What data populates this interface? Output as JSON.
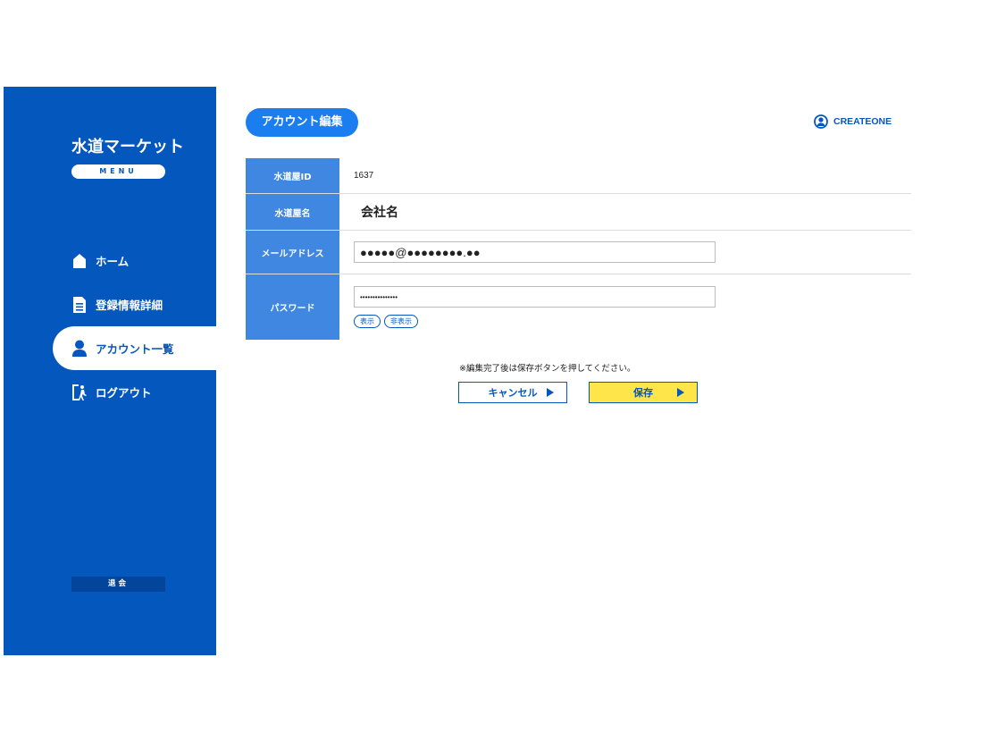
{
  "sidebar": {
    "brand": "水道マーケット",
    "menu_label": "MENU",
    "items": [
      {
        "label": "ホーム",
        "icon": "home-icon"
      },
      {
        "label": "登録情報詳細",
        "icon": "document-icon"
      },
      {
        "label": "アカウント一覧",
        "icon": "user-icon",
        "active": true
      },
      {
        "label": "ログアウト",
        "icon": "logout-icon"
      }
    ],
    "withdraw_label": "退会"
  },
  "header": {
    "title": "アカウント編集",
    "user_name": "CREATEONE"
  },
  "form": {
    "id_label": "水道屋ID",
    "id_value": "1637",
    "name_label": "水道屋名",
    "name_value": "会社名",
    "email_label": "メールアドレス",
    "email_value": "●●●●●@●●●●●●●●.●●",
    "password_label": "パスワード",
    "password_value": "•••••••••••••••",
    "show_label": "表示",
    "hide_label": "非表示"
  },
  "actions": {
    "note": "※編集完了後は保存ボタンを押してください。",
    "cancel_label": "キャンセル",
    "save_label": "保存"
  },
  "colors": {
    "sidebar": "#0457bd",
    "title_pill": "#1a7df0",
    "table_header": "#3f87e0",
    "save_button": "#fde54a"
  }
}
